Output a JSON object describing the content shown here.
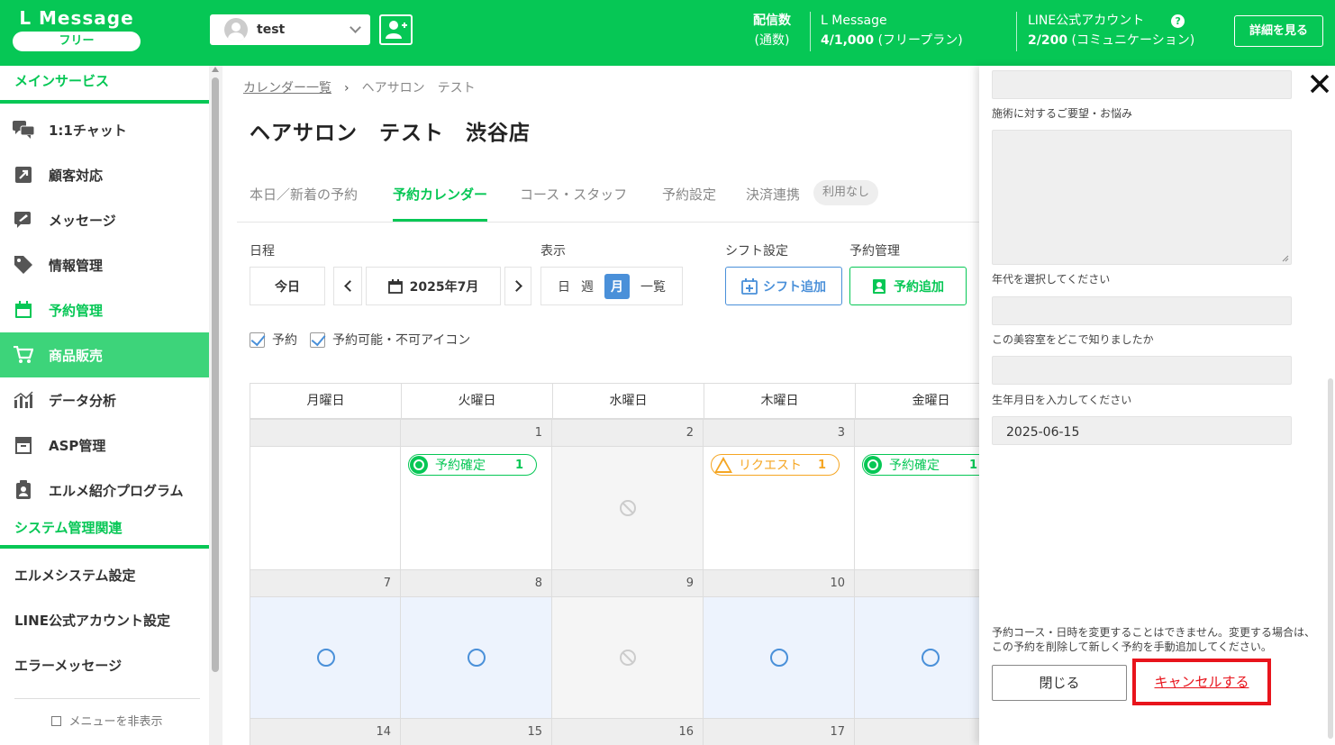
{
  "header": {
    "logo_title": "L Message",
    "logo_badge": "フリー",
    "account_name": "test",
    "sends_label_1": "配信数",
    "sends_label_2": "(通数)",
    "plan_name": "L Message",
    "plan_value": "4/1,000",
    "plan_note": "(フリープラン)",
    "line_label": "LINE公式アカウント",
    "line_value": "2/200",
    "line_note": "(コミュニケーション)",
    "help_glyph": "?",
    "detail_button": "詳細を見る",
    "accent_color": "#06c755"
  },
  "sidebar": {
    "section_main": "メインサービス",
    "items": [
      {
        "label": "1:1チャット",
        "icon": "chat-icon"
      },
      {
        "label": "顧客対応",
        "icon": "arrow-box-icon"
      },
      {
        "label": "メッセージ",
        "icon": "message-edit-icon"
      },
      {
        "label": "情報管理",
        "icon": "tag-icon"
      },
      {
        "label": "予約管理",
        "icon": "calendar-icon"
      },
      {
        "label": "商品販売",
        "icon": "cart-icon"
      },
      {
        "label": "データ分析",
        "icon": "bar-chart-icon"
      },
      {
        "label": "ASP管理",
        "icon": "archive-icon"
      },
      {
        "label": "エルメ紹介プログラム",
        "icon": "clipboard-user-icon"
      }
    ],
    "section_system": "システム管理関連",
    "system_items": [
      "エルメシステム設定",
      "LINE公式アカウント設定",
      "エラーメッセージ"
    ],
    "hide_menu": "メニューを非表示"
  },
  "main": {
    "breadcrumb_link": "カレンダー一覧",
    "breadcrumb_current": "ヘアサロン　テスト",
    "title": "ヘアサロン　テスト　渋谷店",
    "tabs": [
      "本日／新着の予約",
      "予約カレンダー",
      "コース・スタッフ",
      "予約設定",
      "決済連携"
    ],
    "tab_badge": "利用なし",
    "label_schedule": "日程",
    "label_view": "表示",
    "label_shift": "シフト設定",
    "label_reserve": "予約管理",
    "today_button": "今日",
    "month_display": "2025年7月",
    "view_options": [
      "日",
      "週",
      "月",
      "一覧"
    ],
    "view_selected": "月",
    "shift_add": "シフト追加",
    "reserve_add": "予約追加",
    "check_reserve": "予約",
    "check_icons": "予約可能・不可アイコン"
  },
  "calendar": {
    "weekdays": [
      "月曜日",
      "火曜日",
      "水曜日",
      "木曜日",
      "金曜日"
    ],
    "week1_dates": [
      "",
      "1",
      "2",
      "3",
      ""
    ],
    "week2_dates": [
      "7",
      "8",
      "9",
      "10",
      ""
    ],
    "week3_dates": [
      "14",
      "15",
      "16",
      "17",
      ""
    ],
    "pill_confirmed": "予約確定",
    "pill_request": "リクエスト",
    "pill_count": "1"
  },
  "panel": {
    "label_request": "施術に対するご要望・お悩み",
    "label_age": "年代を選択してください",
    "label_source": "この美容室をどこで知りましたか",
    "label_birthday": "生年月日を入力してください",
    "birthday_value": "2025-06-15",
    "note": "予約コース・日時を変更することはできません。変更する場合は、この予約を削除して新しく予約を手動追加してください。",
    "close_button": "閉じる",
    "cancel_button": "キャンセルする",
    "highlight_color": "#e8141c"
  }
}
